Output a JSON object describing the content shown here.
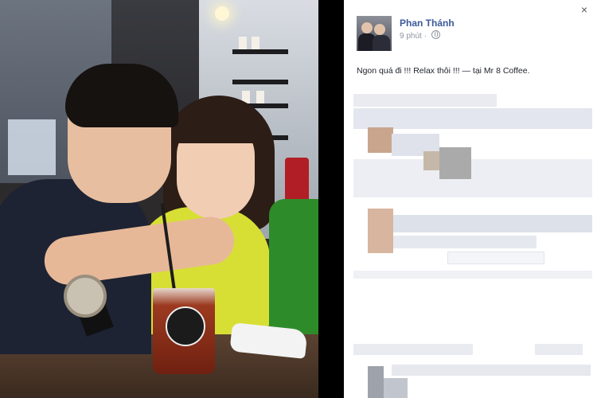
{
  "post": {
    "author": "Phan Thánh",
    "time": "9 phút",
    "separator": "·",
    "text": "Ngon quá đi !!! Relax thôi !!! — tại Mr 8 Coffee.",
    "close_glyph": "×"
  },
  "icons": {
    "close": "close-icon",
    "privacy": "globe-icon"
  }
}
